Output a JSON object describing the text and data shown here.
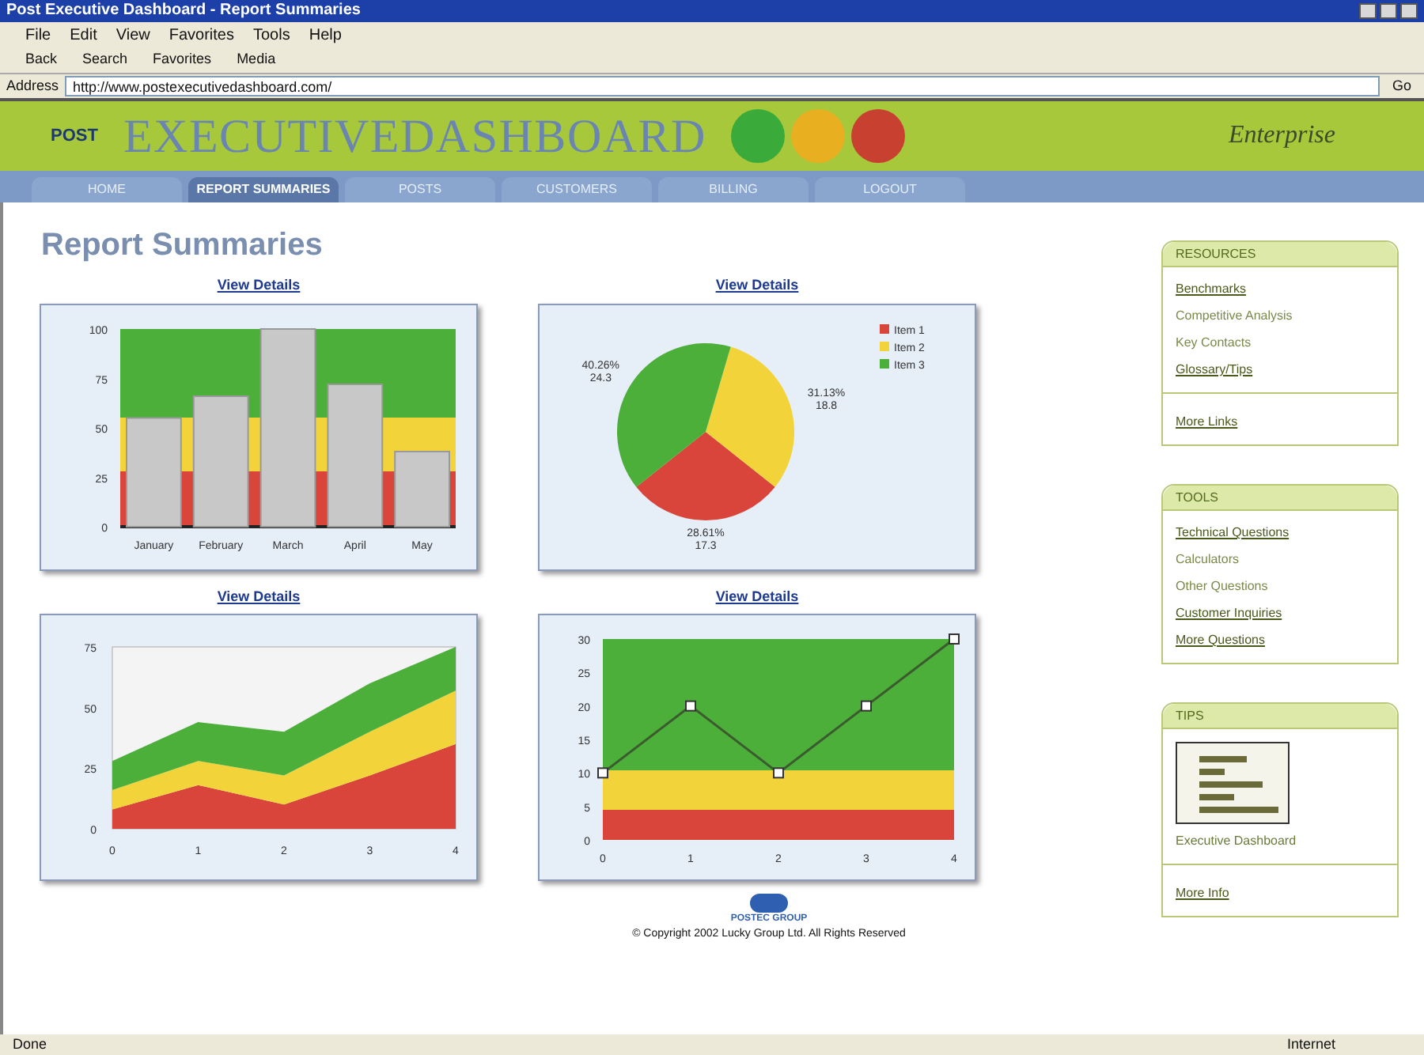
{
  "window": {
    "title": "Post Executive Dashboard - Report Summaries"
  },
  "menu": [
    "File",
    "Edit",
    "View",
    "Favorites",
    "Tools",
    "Help"
  ],
  "toolbar": [
    "Back",
    "Search",
    "Favorites",
    "Media"
  ],
  "address": {
    "label": "Address",
    "value": "http://www.postexecutivedashboard.com/",
    "go": "Go"
  },
  "banner": {
    "logo": "POST",
    "title": "EXECUTIVEDASHBOARD",
    "brand": "Enterprise"
  },
  "nav": [
    {
      "label": "HOME",
      "selected": false
    },
    {
      "label": "REPORT SUMMARIES",
      "selected": true
    },
    {
      "label": "POSTS",
      "selected": false
    },
    {
      "label": "CUSTOMERS",
      "selected": false
    },
    {
      "label": "BILLING",
      "selected": false
    },
    {
      "label": "LOGOUT",
      "selected": false
    }
  ],
  "heading": "Report Summaries",
  "panels": [
    {
      "link": "View Details",
      "chart_data": {
        "type": "bar",
        "categories": [
          "January",
          "February",
          "March",
          "April",
          "May"
        ],
        "values": [
          55,
          66,
          100,
          72,
          38
        ],
        "ylim": [
          0,
          100
        ],
        "yticks": [
          0,
          25,
          50,
          75,
          100
        ]
      }
    },
    {
      "link": "View Details",
      "chart_data": {
        "type": "pie",
        "categories": [
          "Item 1",
          "Item 2",
          "Item 3"
        ],
        "values": [
          17.3,
          18.8,
          24.3
        ],
        "colors": [
          "#d9453a",
          "#f2d33a",
          "#4caf3a"
        ],
        "legend": true,
        "value_labels": [
          "28.61%\n17.3",
          "31.13%\n18.8",
          "40.26%\n24.3"
        ]
      }
    },
    {
      "link": "View Details",
      "chart_data": {
        "type": "area",
        "stacked": true,
        "x": [
          0,
          1,
          2,
          3,
          4
        ],
        "ylim": [
          0,
          75
        ],
        "yticks": [
          0,
          25,
          50,
          75
        ],
        "series": [
          {
            "color": "#d9453a",
            "values": [
              8,
              18,
              10,
              22,
              35
            ]
          },
          {
            "color": "#f2d33a",
            "values": [
              8,
              10,
              12,
              18,
              22
            ]
          },
          {
            "color": "#4caf3a",
            "values": [
              12,
              16,
              18,
              20,
              18
            ]
          }
        ]
      }
    },
    {
      "link": "View Details",
      "chart_data": {
        "type": "line",
        "x": [
          0,
          1,
          2,
          3,
          4
        ],
        "ylim": [
          0,
          30
        ],
        "yticks": [
          0,
          5,
          10,
          15,
          20,
          25,
          30
        ],
        "series": [
          {
            "color": "#3b5a2e",
            "marker": "square",
            "values": [
              10,
              20,
              10,
              20,
              30
            ]
          }
        ]
      }
    }
  ],
  "footer": {
    "logo": "POSTEC GROUP",
    "copyright": "© Copyright 2002 Lucky Group Ltd. All Rights Reserved"
  },
  "sidebar": [
    {
      "title": "RESOURCES",
      "items": [
        {
          "label": "Benchmarks",
          "link": true
        },
        {
          "label": "Competitive Analysis",
          "link": false
        },
        {
          "label": "Key Contacts",
          "link": false
        },
        {
          "label": "Glossary/Tips",
          "link": true
        }
      ],
      "more": "More Links"
    },
    {
      "title": "TOOLS",
      "items": [
        {
          "label": "Technical Questions",
          "link": true
        },
        {
          "label": "Calculators",
          "link": false
        },
        {
          "label": "Other Questions",
          "link": false
        },
        {
          "label": "Customer Inquiries",
          "link": true
        },
        {
          "label": "More Questions",
          "link": true
        }
      ]
    },
    {
      "title": "TIPS",
      "thumbnail": true,
      "caption": "Executive Dashboard",
      "more": "More Info"
    }
  ],
  "status": {
    "text": "Done",
    "zone": "Internet"
  }
}
